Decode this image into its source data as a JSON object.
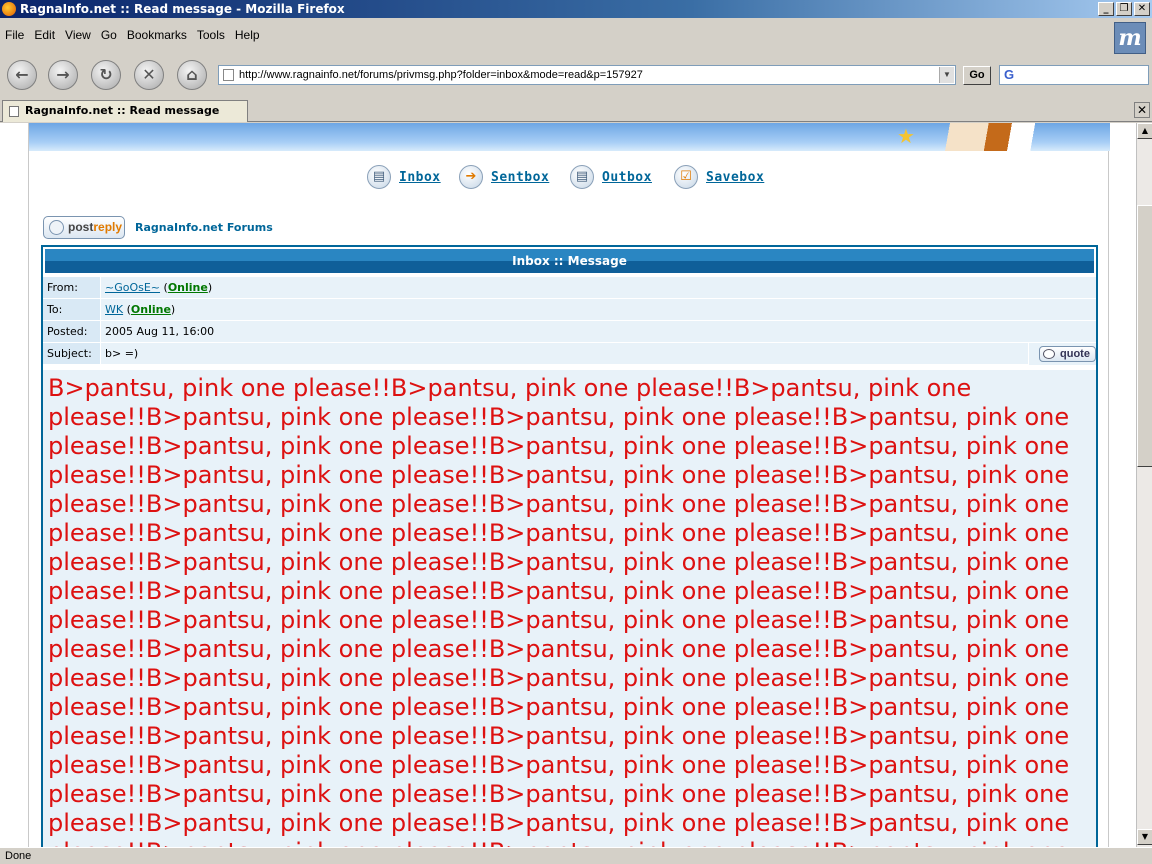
{
  "window": {
    "title": "RagnaInfo.net :: Read message - Mozilla Firefox"
  },
  "menu": [
    "File",
    "Edit",
    "View",
    "Go",
    "Bookmarks",
    "Tools",
    "Help"
  ],
  "toolbar": {
    "url": "http://www.ragnainfo.net/forums/privmsg.php?folder=inbox&mode=read&p=157927",
    "go_label": "Go",
    "search_text": "G"
  },
  "tab": {
    "label": "RagnaInfo.net :: Read message"
  },
  "nav": {
    "inbox": "Inbox",
    "sentbox": "Sentbox",
    "outbox": "Outbox",
    "savebox": "Savebox"
  },
  "postreply": {
    "post": "post",
    "reply": "reply"
  },
  "forum_link": "RagnaInfo.net Forums",
  "message": {
    "header": "Inbox :: Message",
    "from_label": "From:",
    "from_user": "~GoOsE~",
    "from_status": "Online",
    "to_label": "To:",
    "to_user": "WK",
    "to_status": "Online",
    "posted_label": "Posted:",
    "posted_value": "2005 Aug 11, 16:00",
    "subject_label": "Subject:",
    "subject_value": "b> =)",
    "quote_label": "quote",
    "body_unit": "B>pantsu, pink one please!!",
    "body_color": "#dd1111"
  },
  "status": {
    "text": "Done"
  }
}
